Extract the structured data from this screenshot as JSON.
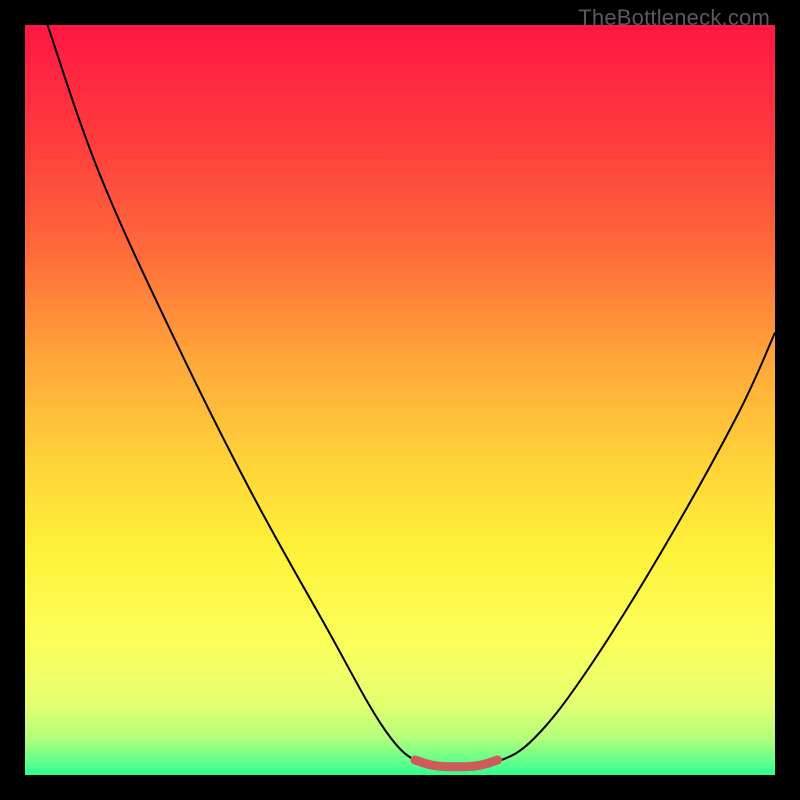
{
  "watermark": "TheBottleneck.com",
  "chart_data": {
    "type": "line",
    "title": "",
    "xlabel": "",
    "ylabel": "",
    "xlim": [
      0,
      100
    ],
    "ylim": [
      0,
      100
    ],
    "gradient_stops": [
      {
        "offset": 0,
        "color": "#ff1744"
      },
      {
        "offset": 15,
        "color": "#ff3b3d"
      },
      {
        "offset": 30,
        "color": "#ff6a3a"
      },
      {
        "offset": 45,
        "color": "#ffa83a"
      },
      {
        "offset": 58,
        "color": "#ffd23a"
      },
      {
        "offset": 70,
        "color": "#fff23a"
      },
      {
        "offset": 82,
        "color": "#fbff5a"
      },
      {
        "offset": 90,
        "color": "#e6ff70"
      },
      {
        "offset": 95,
        "color": "#b5ff7a"
      },
      {
        "offset": 99,
        "color": "#4cff8f"
      },
      {
        "offset": 100,
        "color": "#2eff88"
      }
    ],
    "series": [
      {
        "name": "bottleneck-curve",
        "stroke": "#000000",
        "stroke_width": 2,
        "points": [
          {
            "x": 3,
            "y": 100
          },
          {
            "x": 10,
            "y": 80
          },
          {
            "x": 20,
            "y": 58
          },
          {
            "x": 30,
            "y": 38
          },
          {
            "x": 40,
            "y": 20
          },
          {
            "x": 48,
            "y": 6
          },
          {
            "x": 53,
            "y": 1.5
          },
          {
            "x": 58,
            "y": 1.2
          },
          {
            "x": 63,
            "y": 1.8
          },
          {
            "x": 68,
            "y": 5
          },
          {
            "x": 75,
            "y": 14
          },
          {
            "x": 85,
            "y": 30
          },
          {
            "x": 95,
            "y": 48
          },
          {
            "x": 100,
            "y": 59
          }
        ]
      },
      {
        "name": "flat-bottom-highlight",
        "stroke": "#cf5a5a",
        "stroke_width": 9,
        "points": [
          {
            "x": 52,
            "y": 2
          },
          {
            "x": 55,
            "y": 1.2
          },
          {
            "x": 60,
            "y": 1.2
          },
          {
            "x": 63,
            "y": 2
          }
        ]
      }
    ]
  }
}
